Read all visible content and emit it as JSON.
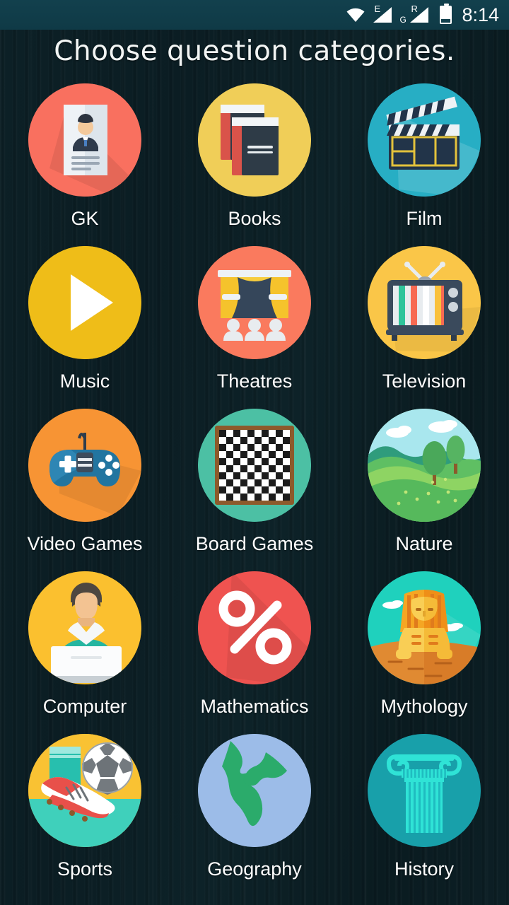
{
  "statusbar": {
    "icons": [
      {
        "name": "wifi-icon",
        "label": ""
      },
      {
        "name": "signal-e-icon",
        "top_label": "E",
        "bottom_label": ""
      },
      {
        "name": "signal-gr-icon",
        "top_label": "R",
        "bottom_label": "G"
      },
      {
        "name": "battery-icon",
        "label": ""
      }
    ],
    "wifi_label": "",
    "signal1_top": "E",
    "signal2_top": "R",
    "signal2_bottom": "G",
    "clock": "8:14",
    "background_color": "#12404d"
  },
  "header": {
    "title": "Choose question categories."
  },
  "theme": {
    "background_color": "#0c2026",
    "label_color": "#ffffff",
    "title_color": "#f2f5f4"
  },
  "grid": {
    "columns": 3,
    "items": [
      {
        "id": "gk",
        "label": "GK",
        "icon": "resume-document-icon",
        "circle_color": "#f9705f"
      },
      {
        "id": "books",
        "label": "Books",
        "icon": "books-icon",
        "circle_color": "#f0ce58"
      },
      {
        "id": "film",
        "label": "Film",
        "icon": "clapperboard-icon",
        "circle_color": "#27aec4"
      },
      {
        "id": "music",
        "label": "Music",
        "icon": "play-triangle-icon",
        "circle_color": "#efbd18"
      },
      {
        "id": "theatres",
        "label": "Theatres",
        "icon": "stage-curtain-icon",
        "circle_color": "#fa7a5e"
      },
      {
        "id": "television",
        "label": "Television",
        "icon": "retro-tv-icon",
        "circle_color": "#fac648"
      },
      {
        "id": "video-games",
        "label": "Video Games",
        "icon": "gamepad-icon",
        "circle_color": "#f79434"
      },
      {
        "id": "board-games",
        "label": "Board Games",
        "icon": "checkerboard-icon",
        "circle_color": "#4cc0a4"
      },
      {
        "id": "nature",
        "label": "Nature",
        "icon": "landscape-trees-icon",
        "circle_color": "#6dc067"
      },
      {
        "id": "computer",
        "label": "Computer",
        "icon": "person-laptop-icon",
        "circle_color": "#fbc02f"
      },
      {
        "id": "mathematics",
        "label": "Mathematics",
        "icon": "percent-sign-icon",
        "circle_color": "#ef5350"
      },
      {
        "id": "mythology",
        "label": "Mythology",
        "icon": "sphinx-icon",
        "circle_color": "#1fd1bd"
      },
      {
        "id": "sports",
        "label": "Sports",
        "icon": "soccer-cleat-icon",
        "circle_color": "#f9c233"
      },
      {
        "id": "geography",
        "label": "Geography",
        "icon": "globe-icon",
        "circle_color": "#9cbce8"
      },
      {
        "id": "history",
        "label": "History",
        "icon": "ionic-column-icon",
        "circle_color": "#18a0aa"
      }
    ]
  }
}
